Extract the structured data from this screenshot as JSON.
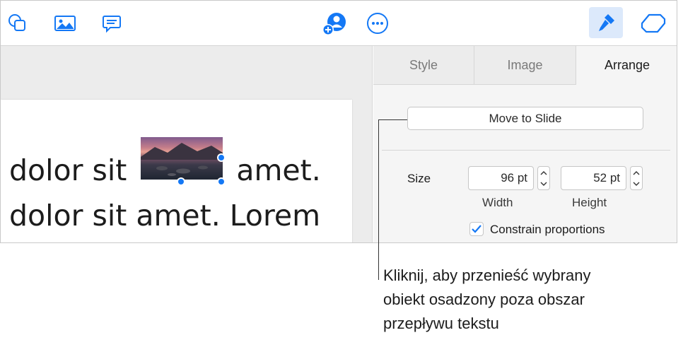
{
  "toolbar": {
    "icons": [
      "shape-icon",
      "media-icon",
      "comment-icon",
      "collaborate-icon",
      "more-icon",
      "format-icon",
      "document-icon"
    ],
    "accent_color": "#1478f5"
  },
  "document": {
    "line1_before": "dolor sit ",
    "line1_after": "amet.",
    "line2": "dolor sit amet. Lorem"
  },
  "inspector": {
    "tabs": [
      {
        "label": "Style",
        "selected": false
      },
      {
        "label": "Image",
        "selected": false
      },
      {
        "label": "Arrange",
        "selected": true
      }
    ],
    "move_button_label": "Move to Slide",
    "size_label": "Size",
    "width_value": "96 pt",
    "height_value": "52 pt",
    "width_label": "Width",
    "height_label": "Height",
    "constrain_label": "Constrain proportions",
    "constrain_checked": true
  },
  "callout": {
    "lines": [
      "Kliknij, aby przenieść wybrany",
      "obiekt osadzony poza obszar",
      "przepływu tekstu"
    ]
  }
}
